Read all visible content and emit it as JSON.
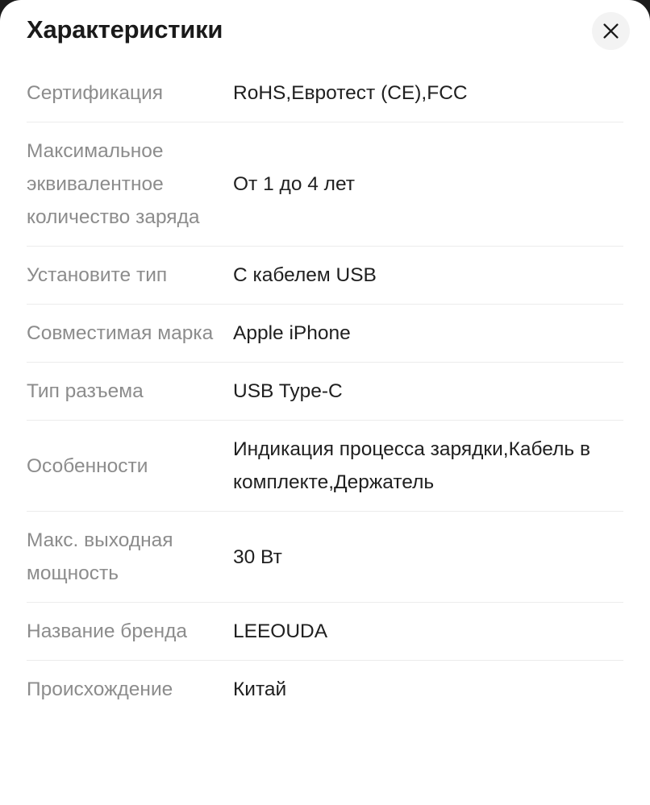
{
  "modal": {
    "title": "Характеристики",
    "close_label": "×",
    "close_icon": "close-icon",
    "accent_colors": {
      "panel_background": "#ffffff",
      "backdrop": "#1b1b1b",
      "title_text": "#1a1a1a",
      "label_text": "#8c8c8c",
      "value_text": "#1f1f1f",
      "divider": "#ececec",
      "close_button_background": "#f3f3f3"
    }
  },
  "specs": {
    "rows": [
      {
        "label": "Сертификация",
        "value": "RoHS,Евротест (CE),FCC"
      },
      {
        "label": "Максимальное эквивалентное количество заряда",
        "value": "От 1 до 4 лет"
      },
      {
        "label": "Установите тип",
        "value": "С кабелем USB"
      },
      {
        "label": "Совместимая марка",
        "value": "Apple iPhone"
      },
      {
        "label": "Тип разъема",
        "value": "USB Type-C"
      },
      {
        "label": "Особенности",
        "value": "Индикация процесса зарядки,Кабель в комплекте,Держатель"
      },
      {
        "label": "Макс. выходная мощность",
        "value": "30 Вт"
      },
      {
        "label": "Название бренда",
        "value": "LEEOUDA"
      },
      {
        "label": "Происхождение",
        "value": "Китай"
      }
    ]
  }
}
